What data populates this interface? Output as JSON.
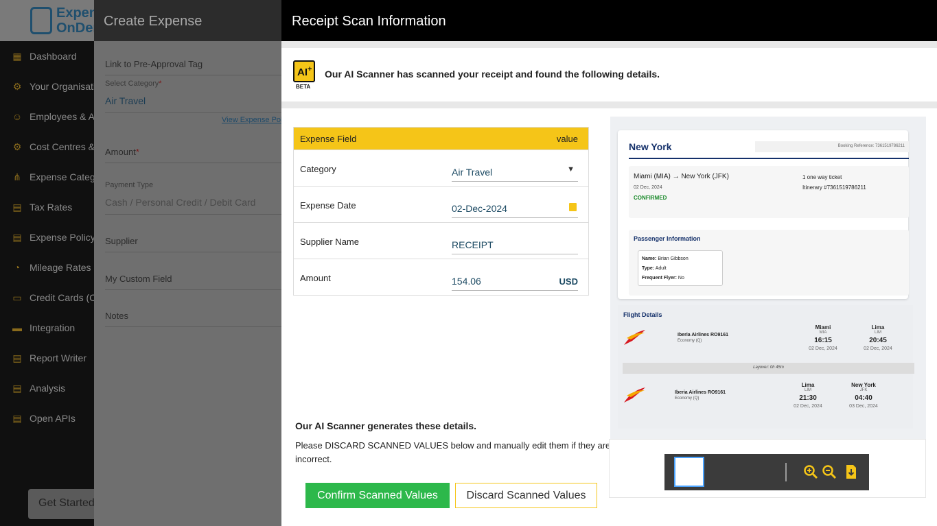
{
  "sidebar": {
    "logo_text": "Expense OnDemand",
    "items": [
      {
        "label": "Dashboard",
        "icon": "dashboard-icon"
      },
      {
        "label": "Your Organisation",
        "icon": "organisation-icon"
      },
      {
        "label": "Employees & Approvers",
        "icon": "employees-icon"
      },
      {
        "label": "Cost Centres & Projects",
        "icon": "cost-centres-icon"
      },
      {
        "label": "Expense Categories",
        "icon": "expense-categories-icon"
      },
      {
        "label": "Tax Rates",
        "icon": "tax-rates-icon"
      },
      {
        "label": "Expense Policy",
        "icon": "expense-policy-icon"
      },
      {
        "label": "Mileage Rates",
        "icon": "mileage-rates-icon"
      },
      {
        "label": "Credit Cards (CC)",
        "icon": "credit-cards-icon"
      },
      {
        "label": "Integration",
        "icon": "integration-icon"
      },
      {
        "label": "Report Writer",
        "icon": "report-writer-icon"
      },
      {
        "label": "Analysis",
        "icon": "analysis-icon"
      },
      {
        "label": "Open APIs",
        "icon": "open-apis-icon"
      }
    ],
    "get_started": "Get Started"
  },
  "create_expense": {
    "title": "Create Expense",
    "link_pre_approval": "Link to Pre-Approval Tag",
    "select_category_label": "Select Category",
    "select_category_value": "Air Travel",
    "view_policy": "View Expense Policy",
    "amount_label": "Amount",
    "payment_type_label": "Payment Type",
    "payment_type_value": "Cash / Personal Credit / Debit Card",
    "supplier_label": "Supplier",
    "custom_field_label": "My Custom Field",
    "notes_label": "Notes"
  },
  "modal": {
    "title": "Receipt Scan Information",
    "ai_badge": "AI",
    "beta": "BETA",
    "ai_message": "Our AI Scanner has scanned your receipt and found the following details.",
    "table": {
      "col_field": "Expense Field",
      "col_value": "value",
      "rows": [
        {
          "label": "Category",
          "value": "Air Travel"
        },
        {
          "label": "Expense Date",
          "value": "02-Dec-2024"
        },
        {
          "label": "Supplier Name",
          "value": "RECEIPT"
        },
        {
          "label": "Amount",
          "value": "154.06",
          "currency": "USD"
        }
      ]
    },
    "generated_title": "Our AI Scanner generates these details.",
    "generated_desc": "Please DISCARD SCANNED VALUES below and manually edit them if they are incorrect.",
    "confirm_button": "Confirm Scanned Values",
    "discard_button": "Discard Scanned Values"
  },
  "receipt": {
    "city": "New York",
    "booking_ref": "Booking Reference: 7361519786211",
    "route": "Miami (MIA) → New York (JFK)",
    "date": "02 Dec, 2024",
    "status": "CONFIRMED",
    "ticket_type": "1 one way ticket",
    "itinerary": "Itinerary #7361519786211",
    "passenger_title": "Passenger Information",
    "passenger_name_label": "Name:",
    "passenger_name": "Brian Gibbson",
    "passenger_type_label": "Type:",
    "passenger_type": "Adult",
    "frequent_flyer_label": "Frequent Flyer:",
    "frequent_flyer": "No",
    "flight_details_title": "Flight Details",
    "layover": "Layover: 0h 45m",
    "flights": [
      {
        "airline": "Iberia Airlines RO9161",
        "class": "Economy (Q)",
        "from_city": "Miami",
        "from_code": "MIA",
        "from_time": "16:15",
        "from_date": "02 Dec, 2024",
        "to_city": "Lima",
        "to_code": "LIM",
        "to_time": "20:45",
        "to_date": "02 Dec, 2024"
      },
      {
        "airline": "Iberia Airlines RO9161",
        "class": "Economy (Q)",
        "from_city": "Lima",
        "from_code": "LIM",
        "from_time": "21:30",
        "from_date": "02 Dec, 2024",
        "to_city": "New York",
        "to_code": "JFK",
        "to_time": "04:40",
        "to_date": "03 Dec, 2024"
      }
    ]
  },
  "viewer": {
    "icons": [
      "zoom-in-icon",
      "zoom-out-icon",
      "download-icon"
    ]
  },
  "colors": {
    "accent_yellow": "#f5c518",
    "confirm_green": "#2db84b",
    "navy": "#14306a"
  }
}
